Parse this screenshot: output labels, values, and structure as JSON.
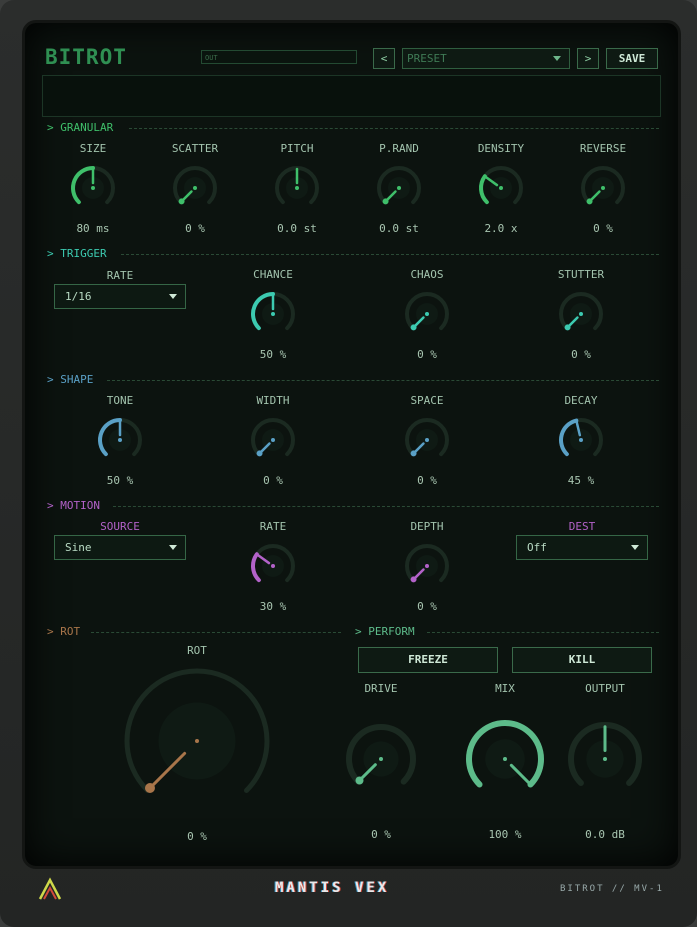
{
  "header": {
    "title": "BITROT",
    "out_label": "OUT",
    "prev_label": "<",
    "preset_label": "PRESET",
    "next_label": ">",
    "save_label": "SAVE"
  },
  "sections": {
    "granular": "> GRANULAR",
    "trigger": "> TRIGGER",
    "shape": "> SHAPE",
    "motion": "> MOTION",
    "rot": "> ROT",
    "perform": "> PERFORM"
  },
  "granular": [
    {
      "label": "SIZE",
      "value": "80 ms",
      "level": 0.5
    },
    {
      "label": "SCATTER",
      "value": "0 %",
      "level": 0.0
    },
    {
      "label": "PITCH",
      "value": "0.0 st",
      "level": 0.5
    },
    {
      "label": "P.RAND",
      "value": "0.0 st",
      "level": 0.0
    },
    {
      "label": "DENSITY",
      "value": "2.0 x",
      "level": 0.3
    },
    {
      "label": "REVERSE",
      "value": "0 %",
      "level": 0.0
    }
  ],
  "trigger": {
    "rate_label": "RATE",
    "rate_value": "1/16",
    "knobs": [
      {
        "label": "CHANCE",
        "value": "50 %",
        "level": 0.5
      },
      {
        "label": "CHAOS",
        "value": "0 %",
        "level": 0.0
      },
      {
        "label": "STUTTER",
        "value": "0 %",
        "level": 0.0
      }
    ]
  },
  "shape": [
    {
      "label": "TONE",
      "value": "50 %",
      "level": 0.5
    },
    {
      "label": "WIDTH",
      "value": "0 %",
      "level": 0.0
    },
    {
      "label": "SPACE",
      "value": "0 %",
      "level": 0.0
    },
    {
      "label": "DECAY",
      "value": "45 %",
      "level": 0.45
    }
  ],
  "motion": {
    "source_label": "SOURCE",
    "source_value": "Sine",
    "rate": {
      "label": "RATE",
      "value": "30 %",
      "level": 0.3
    },
    "depth": {
      "label": "DEPTH",
      "value": "0 %",
      "level": 0.0
    },
    "dest_label": "DEST",
    "dest_value": "Off"
  },
  "rot": {
    "label": "ROT",
    "value": "0 %",
    "level": 0.0
  },
  "perform": {
    "freeze_label": "FREEZE",
    "kill_label": "KILL",
    "knobs": [
      {
        "label": "DRIVE",
        "value": "0 %",
        "level": 0.0
      },
      {
        "label": "MIX",
        "value": "100 %",
        "level": 1.0
      },
      {
        "label": "OUTPUT",
        "value": "0.0 dB",
        "level": 0.5
      }
    ]
  },
  "footer": {
    "logo_icon": "triangle-logo-icon",
    "brand": "MANTIS VEX",
    "model": "BITROT // MV-1"
  },
  "colors": {
    "granular": "#3fbf6a",
    "trigger": "#3ccab0",
    "shape": "#5aa0c6",
    "motion": "#b362c9",
    "rot": "#a8754a",
    "perform": "#5dbb8a"
  }
}
